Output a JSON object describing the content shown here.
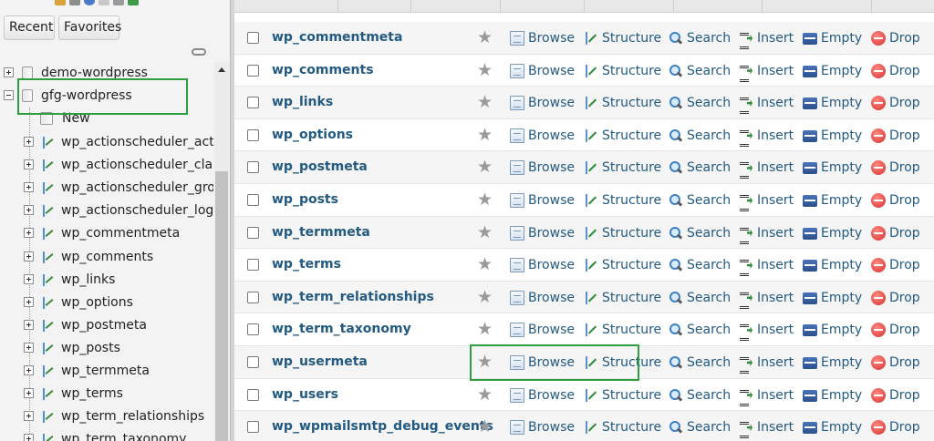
{
  "sidebar": {
    "tabs": {
      "recent": "Recent",
      "favorites": "Favorites"
    },
    "databases": [
      {
        "name": "demo-wordpress",
        "expanded": false
      },
      {
        "name": "gfg-wordpress",
        "expanded": true
      }
    ],
    "new_label": "New",
    "tables": [
      "wp_actionscheduler_actio",
      "wp_actionscheduler_claim",
      "wp_actionscheduler_group",
      "wp_actionscheduler_logs",
      "wp_commentmeta",
      "wp_comments",
      "wp_links",
      "wp_options",
      "wp_postmeta",
      "wp_posts",
      "wp_termmeta",
      "wp_terms",
      "wp_term_relationships",
      "wp_term_taxonomy"
    ]
  },
  "actions": {
    "browse": "Browse",
    "structure": "Structure",
    "search": "Search",
    "insert": "Insert",
    "empty": "Empty",
    "drop": "Drop"
  },
  "table_rows": [
    "wp_commentmeta",
    "wp_comments",
    "wp_links",
    "wp_options",
    "wp_postmeta",
    "wp_posts",
    "wp_termmeta",
    "wp_terms",
    "wp_term_relationships",
    "wp_term_taxonomy",
    "wp_usermeta",
    "wp_users",
    "wp_wpmailsmtp_debug_events"
  ],
  "colors": {
    "highlight": "#2e9e3e",
    "link": "#235a81",
    "row_alt": "#f5f5f5"
  },
  "icons": {
    "browse": "browse-icon",
    "structure": "structure-icon",
    "search": "search-icon",
    "insert": "insert-icon",
    "empty": "empty-icon",
    "drop": "drop-icon",
    "favorite": "star-icon"
  }
}
